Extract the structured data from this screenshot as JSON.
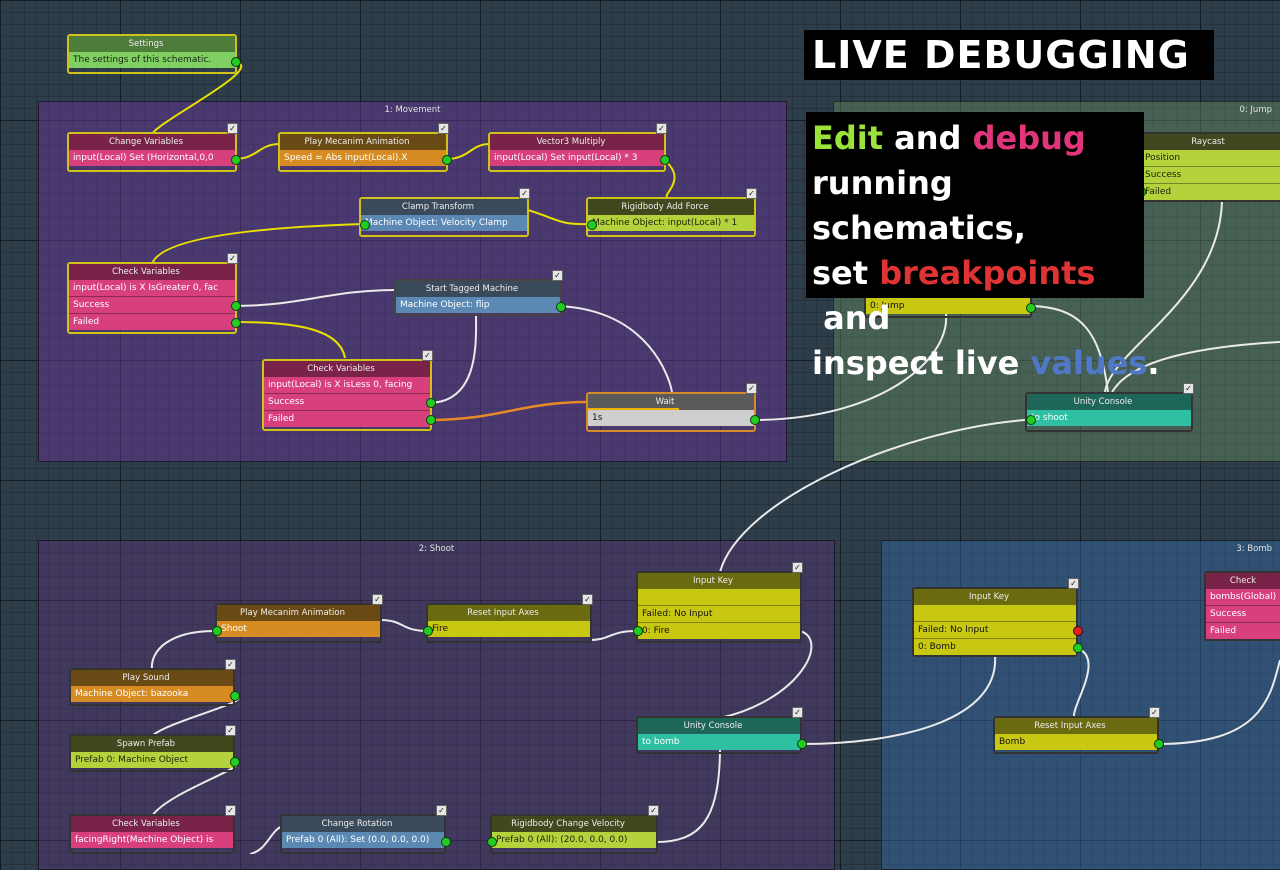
{
  "overlay": {
    "title": "LIVE DEBUGGING",
    "caption": {
      "part1": "Edit",
      "part2": " and ",
      "part3": "debug",
      "part4": "running schematics,",
      "part5": "set ",
      "part6": "breakpoints",
      "part7": " and",
      "part8": "inspect live ",
      "part9": "values",
      "part10": "."
    },
    "colors": {
      "edit": "#9be23a",
      "debug": "#e0357a",
      "breakpoints": "#e03333",
      "values": "#4f78c8"
    }
  },
  "groups": {
    "movement": "1: Movement",
    "jump": "0: Jump",
    "shoot": "2: Shoot",
    "bomb": "3: Bomb"
  },
  "nodes": {
    "settings": {
      "title": "Settings",
      "rows": [
        "The settings of this schematic."
      ]
    },
    "change_variables": {
      "title": "Change Variables",
      "rows": [
        "input(Local) Set (Horizontal,0,0"
      ]
    },
    "play_mecanim_1": {
      "title": "Play Mecanim Animation",
      "rows": [
        "Speed = Abs input(Local).X"
      ]
    },
    "vector3_multiply": {
      "title": "Vector3 Multiply",
      "rows": [
        "input(Local) Set input(Local) * 3"
      ]
    },
    "clamp_transform": {
      "title": "Clamp Transform",
      "rows": [
        "Machine Object: Velocity Clamp"
      ]
    },
    "rigidbody_add_force": {
      "title": "Rigidbody Add Force",
      "rows": [
        "Machine Object: input(Local) * 1"
      ]
    },
    "check_variables_1": {
      "title": "Check Variables",
      "rows": [
        "input(Local) is X IsGreater 0, fac",
        "Success",
        "Failed"
      ]
    },
    "start_tagged_machine": {
      "title": "Start Tagged Machine",
      "rows": [
        "Machine Object: flip"
      ]
    },
    "check_variables_2": {
      "title": "Check Variables",
      "rows": [
        "input(Local) is X isLess 0, facing",
        "Success",
        "Failed"
      ]
    },
    "wait": {
      "title": "Wait",
      "rows": [
        "1s"
      ],
      "progress": 0.55
    },
    "raycast": {
      "title": "Raycast",
      "rows": [
        "Position",
        "Success",
        "Failed"
      ]
    },
    "jump_node": {
      "rows": [
        "0: Jump"
      ]
    },
    "unity_console_1": {
      "title": "Unity Console",
      "rows": [
        "to shoot"
      ]
    },
    "play_mecanim_2": {
      "title": "Play Mecanim Animation",
      "rows": [
        "Shoot"
      ]
    },
    "reset_input_axes_1": {
      "title": "Reset Input Axes",
      "rows": [
        "Fire"
      ]
    },
    "input_key_1": {
      "title": "Input Key",
      "rows": [
        "",
        "Failed: No Input",
        "0: Fire"
      ]
    },
    "play_sound": {
      "title": "Play Sound",
      "rows": [
        "Machine Object: bazooka"
      ]
    },
    "spawn_prefab": {
      "title": "Spawn Prefab",
      "rows": [
        "Prefab 0: Machine Object"
      ]
    },
    "unity_console_2": {
      "title": "Unity Console",
      "rows": [
        "to bomb"
      ]
    },
    "check_variables_3": {
      "title": "Check Variables",
      "rows": [
        "facingRight(Machine Object) is"
      ]
    },
    "change_rotation": {
      "title": "Change Rotation",
      "rows": [
        "Prefab 0 (All): Set (0.0, 0.0, 0.0)"
      ]
    },
    "rigidbody_change_velocity": {
      "title": "Rigidbody Change Velocity",
      "rows": [
        "Prefab 0 (All): (20.0, 0.0, 0.0)"
      ]
    },
    "input_key_2": {
      "title": "Input Key",
      "rows": [
        "",
        "Failed: No Input",
        "0: Bomb"
      ]
    },
    "reset_input_axes_2": {
      "title": "Reset Input Axes",
      "rows": [
        "Bomb"
      ]
    },
    "check_bomb": {
      "title": "Check",
      "rows": [
        "bombs(Global)",
        "Success",
        "Failed"
      ]
    }
  },
  "checkbox_glyph": "✓"
}
